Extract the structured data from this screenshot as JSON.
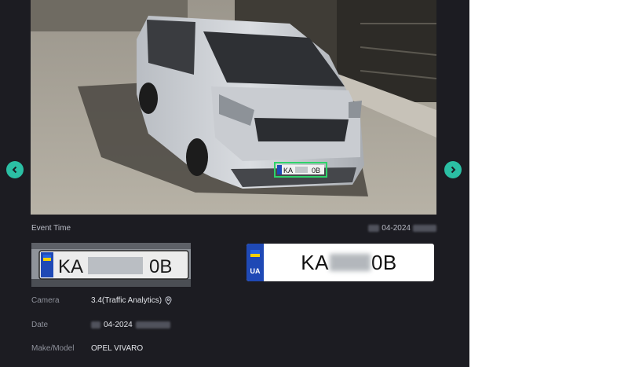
{
  "navigation": {
    "prev_icon": "chevron-left-icon",
    "next_icon": "chevron-right-icon",
    "accent_color": "#2bbfa4"
  },
  "event": {
    "label": "Event Time",
    "time_partial": "04-2024"
  },
  "plate": {
    "country_code": "UA",
    "prefix": "KA",
    "suffix": "0B",
    "photo_prefix": "KA",
    "photo_suffix": "0B"
  },
  "details": {
    "camera_label": "Camera",
    "camera_value": "3.4(Traffic Analytics)",
    "camera_icon": "location-pin-icon",
    "date_label": "Date",
    "date_partial": "04-2024",
    "make_label": "Make/Model",
    "make_value": "OPEL VIVARO"
  }
}
